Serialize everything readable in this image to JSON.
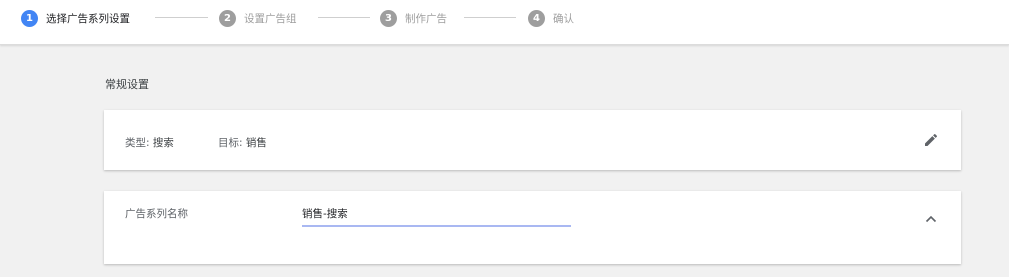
{
  "stepper": {
    "steps": [
      {
        "number": "1",
        "label": "选择广告系列设置",
        "state": "active"
      },
      {
        "number": "2",
        "label": "设置广告组",
        "state": "inactive"
      },
      {
        "number": "3",
        "label": "制作广告",
        "state": "inactive"
      },
      {
        "number": "4",
        "label": "确认",
        "state": "inactive"
      }
    ]
  },
  "main": {
    "section_title": "常规设置",
    "summary_card": {
      "type_label": "类型: ",
      "type_value": "搜索",
      "goal_label": "目标: ",
      "goal_value": "销售",
      "edit_icon": "pencil-icon"
    },
    "name_card": {
      "label": "广告系列名称",
      "value": "销售-搜索",
      "collapse_icon": "chevron-up-icon"
    }
  },
  "colors": {
    "accent": "#4285f4",
    "inactive": "#9e9e9e",
    "underline": "#a9b8f2",
    "background": "#f1f1f1"
  }
}
